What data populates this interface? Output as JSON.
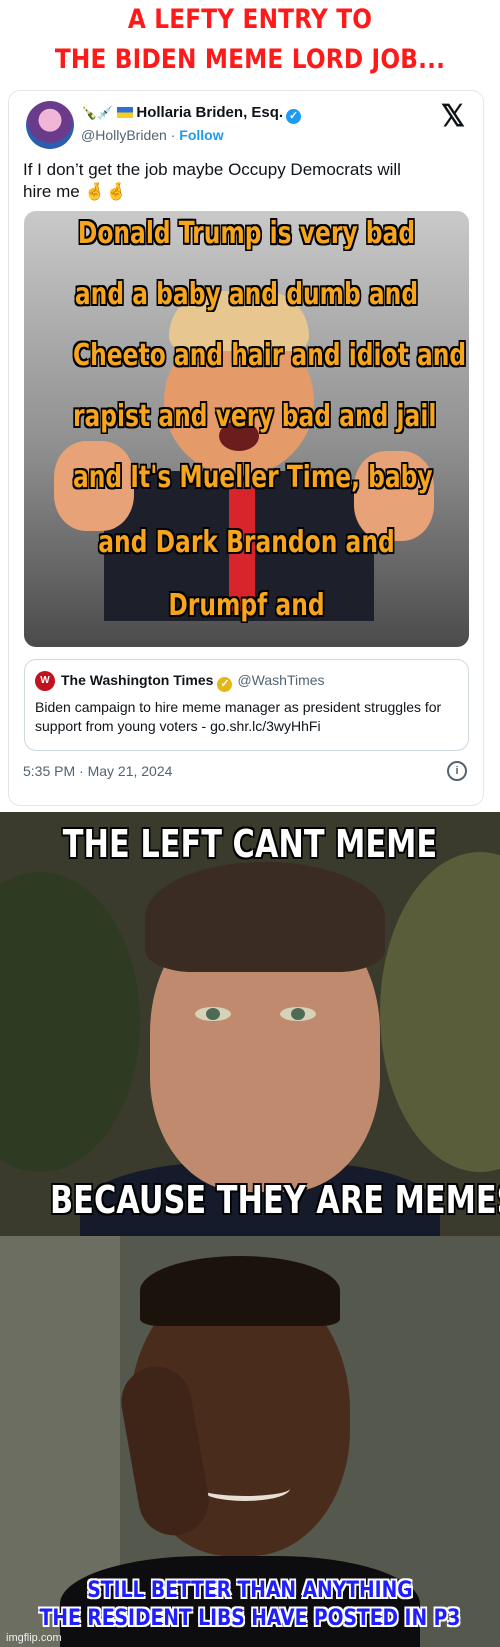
{
  "caption": {
    "line1": "A LEFTY ENTRY TO",
    "line2": "THE BIDEN MEME LORD JOB..."
  },
  "tweet": {
    "display_name": "Hollaria Briden, Esq.",
    "handle": "@HollyBriden",
    "follow_label": "Follow",
    "text_line1": "If I don’t get the job maybe Occupy Democrats will",
    "text_line2": "hire me 🤞🤞",
    "media_lines": [
      "Donald Trump is very bad",
      "and a baby and dumb and",
      "Cheeto and hair and idiot and",
      "rapist and very bad and jail",
      "and It's Mueller Time, baby",
      "and Dark Brandon and",
      "Drumpf and"
    ],
    "quote": {
      "logo_text": "W",
      "name": "The Washington Times",
      "handle": "@WashTimes",
      "text_line1": "Biden campaign to hire meme manager as president struggles for",
      "text_line2": "support from young voters - go.shr.lc/3wyHhFi"
    },
    "timestamp": "5:35 PM · May 21, 2024"
  },
  "meme2": {
    "top": "THE LEFT CANT MEME",
    "bottom": "BECAUSE THEY ARE MEMES"
  },
  "meme3": {
    "line1": "STILL BETTER THAN ANYTHING",
    "line2": "THE RESIDENT LIBS HAVE POSTED IN P3"
  },
  "watermark": "imgflip.com",
  "colors": {
    "caption_red": "#ff1a1a",
    "twitter_blue": "#1d9bf0",
    "meme_orange": "#f7a51c",
    "meme3_blue": "#1e1eff"
  }
}
